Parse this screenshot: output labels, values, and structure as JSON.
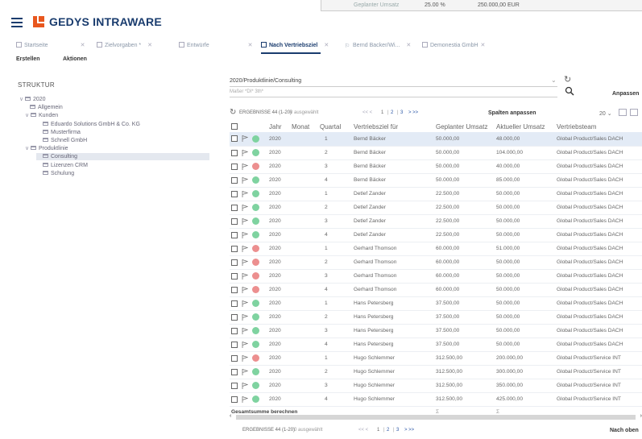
{
  "background_window": {
    "col1": "Geplanter Umsatz",
    "col2": "25.00 %",
    "col3": "250.000,00 EUR"
  },
  "app": {
    "title": "GEDYS INTRAWARE",
    "brand_color": "#e8571e",
    "accent": "#1a3c6e"
  },
  "tabs": [
    {
      "label": "Startseite"
    },
    {
      "label": "Zielvorgaben *"
    },
    {
      "label": "Entwürfe"
    },
    {
      "label": "Nach Vertriebsziel"
    },
    {
      "label": "Bernd Backer/Wi..."
    },
    {
      "label": "Demonestia GmbH"
    }
  ],
  "toolbar": {
    "create": "Erstellen",
    "actions": "Aktionen"
  },
  "sidebar": {
    "title": "STRUKTUR",
    "tree": [
      {
        "label": "2020"
      },
      {
        "label": "Allgemein"
      },
      {
        "label": "Kunden"
      },
      {
        "label": "Eduardo Solutions GmbH & Co. KG"
      },
      {
        "label": "Musterfirma"
      },
      {
        "label": "Schnell GmbH"
      },
      {
        "label": "Produktlinie"
      },
      {
        "label": "Consulting"
      },
      {
        "label": "Lizenzen CRM"
      },
      {
        "label": "Schulung"
      }
    ]
  },
  "main": {
    "path": "2020/Produktlinie/Consulting",
    "filter_placeholder": "Maßer *DI* 3th*",
    "customize": "Anpassen",
    "results": "ERGEBNISSE 44 (1-20)",
    "selected": "0 ausgewählt",
    "pager": [
      "<< <",
      "1",
      "2",
      "3",
      "> >>"
    ],
    "columns_adjust": "Spalten anpassen",
    "page_size": "20",
    "back_to_top": "Nach oben",
    "sum_label": "Gesamtsumme berechnen",
    "sum_sym1": "Σ",
    "sum_sym2": "Σ"
  },
  "grid": {
    "headers": [
      "Jahr",
      "Monat",
      "Quartal",
      "Vertriebsziel für",
      "Geplanter Umsatz",
      "Aktueller Umsatz",
      "Vertriebsteam"
    ],
    "rows": [
      {
        "status": "green",
        "year": "2020",
        "quarter": "1",
        "person": "Bernd Bäcker",
        "planned": "50.000,00",
        "actual": "48.000,00",
        "team": "Global Product/Sales DACH"
      },
      {
        "status": "green",
        "year": "2020",
        "quarter": "2",
        "person": "Bernd Bäcker",
        "planned": "50.000,00",
        "actual": "104.000,00",
        "team": "Global Product/Sales DACH"
      },
      {
        "status": "red",
        "year": "2020",
        "quarter": "3",
        "person": "Bernd Bäcker",
        "planned": "50.000,00",
        "actual": "40.000,00",
        "team": "Global Product/Sales DACH"
      },
      {
        "status": "green",
        "year": "2020",
        "quarter": "4",
        "person": "Bernd Bäcker",
        "planned": "50.000,00",
        "actual": "85.000,00",
        "team": "Global Product/Sales DACH"
      },
      {
        "status": "green",
        "year": "2020",
        "quarter": "1",
        "person": "Detlef Zander",
        "planned": "22.500,00",
        "actual": "50.000,00",
        "team": "Global Product/Sales DACH"
      },
      {
        "status": "green",
        "year": "2020",
        "quarter": "2",
        "person": "Detlef Zander",
        "planned": "22.500,00",
        "actual": "50.000,00",
        "team": "Global Product/Sales DACH"
      },
      {
        "status": "green",
        "year": "2020",
        "quarter": "3",
        "person": "Detlef Zander",
        "planned": "22.500,00",
        "actual": "50.000,00",
        "team": "Global Product/Sales DACH"
      },
      {
        "status": "green",
        "year": "2020",
        "quarter": "4",
        "person": "Detlef Zander",
        "planned": "22.500,00",
        "actual": "50.000,00",
        "team": "Global Product/Sales DACH"
      },
      {
        "status": "red",
        "year": "2020",
        "quarter": "1",
        "person": "Gerhard Thomson",
        "planned": "60.000,00",
        "actual": "51.000,00",
        "team": "Global Product/Sales DACH"
      },
      {
        "status": "red",
        "year": "2020",
        "quarter": "2",
        "person": "Gerhard Thomson",
        "planned": "60.000,00",
        "actual": "50.000,00",
        "team": "Global Product/Sales DACH"
      },
      {
        "status": "red",
        "year": "2020",
        "quarter": "3",
        "person": "Gerhard Thomson",
        "planned": "60.000,00",
        "actual": "50.000,00",
        "team": "Global Product/Sales DACH"
      },
      {
        "status": "red",
        "year": "2020",
        "quarter": "4",
        "person": "Gerhard Thomson",
        "planned": "60.000,00",
        "actual": "50.000,00",
        "team": "Global Product/Sales DACH"
      },
      {
        "status": "green",
        "year": "2020",
        "quarter": "1",
        "person": "Hans Petersberg",
        "planned": "37.500,00",
        "actual": "50.000,00",
        "team": "Global Product/Sales DACH"
      },
      {
        "status": "green",
        "year": "2020",
        "quarter": "2",
        "person": "Hans Petersberg",
        "planned": "37.500,00",
        "actual": "50.000,00",
        "team": "Global Product/Sales DACH"
      },
      {
        "status": "green",
        "year": "2020",
        "quarter": "3",
        "person": "Hans Petersberg",
        "planned": "37.500,00",
        "actual": "50.000,00",
        "team": "Global Product/Sales DACH"
      },
      {
        "status": "green",
        "year": "2020",
        "quarter": "4",
        "person": "Hans Petersberg",
        "planned": "37.500,00",
        "actual": "50.000,00",
        "team": "Global Product/Sales DACH"
      },
      {
        "status": "red",
        "year": "2020",
        "quarter": "1",
        "person": "Hugo Schlemmer",
        "planned": "312.500,00",
        "actual": "200.000,00",
        "team": "Global Product/Service INT"
      },
      {
        "status": "green",
        "year": "2020",
        "quarter": "2",
        "person": "Hugo Schlemmer",
        "planned": "312.500,00",
        "actual": "300.000,00",
        "team": "Global Product/Service INT"
      },
      {
        "status": "green",
        "year": "2020",
        "quarter": "3",
        "person": "Hugo Schlemmer",
        "planned": "312.500,00",
        "actual": "350.000,00",
        "team": "Global Product/Service INT"
      },
      {
        "status": "green",
        "year": "2020",
        "quarter": "4",
        "person": "Hugo Schlemmer",
        "planned": "312.500,00",
        "actual": "425.000,00",
        "team": "Global Product/Service INT"
      }
    ]
  },
  "colors": {
    "status_green": "#7fd3a0",
    "status_red": "#ec8f8f",
    "selected_row": "#e3ebf6"
  }
}
